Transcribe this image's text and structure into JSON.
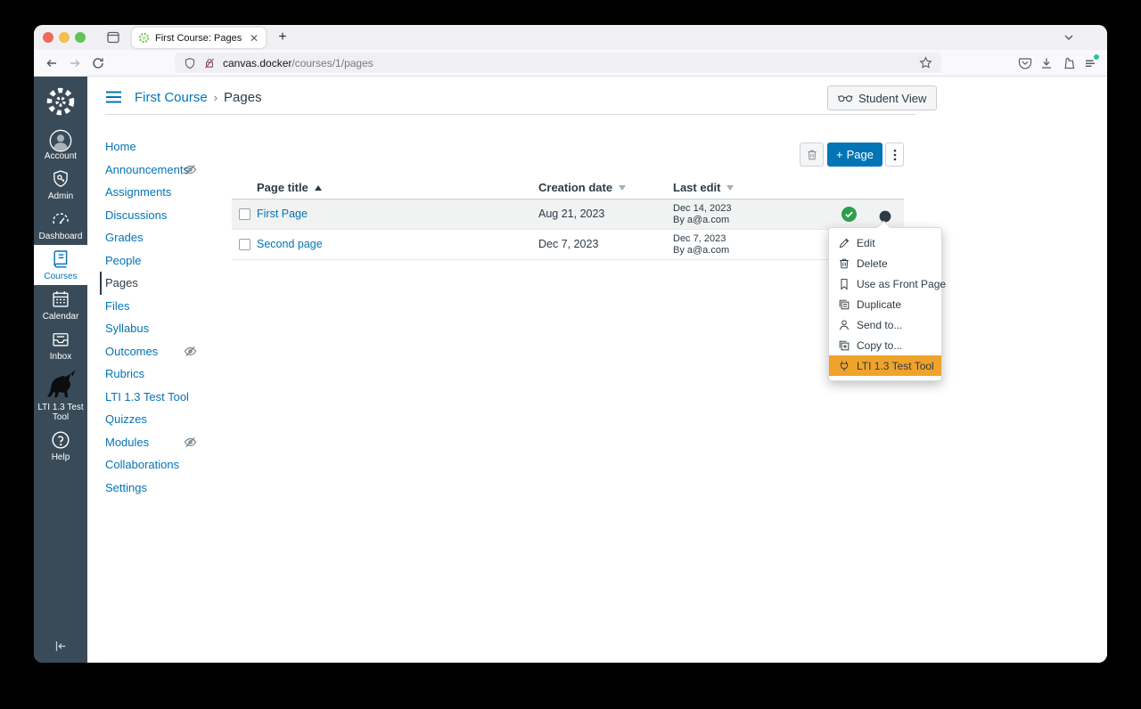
{
  "colors": {
    "accent_blue": "#0374B5",
    "sidebar_bg": "#394B58",
    "published_green": "#2D9F4B",
    "menu_highlight_orange": "#F0A32B"
  },
  "browser": {
    "tab_title": "First Course: Pages",
    "url_host": "canvas.docker",
    "url_path": "/courses/1/pages"
  },
  "global_nav": {
    "items": [
      {
        "label": "Account",
        "icon": "avatar-icon"
      },
      {
        "label": "Admin",
        "icon": "shield-key-icon"
      },
      {
        "label": "Dashboard",
        "icon": "gauge-icon"
      },
      {
        "label": "Courses",
        "icon": "book-icon",
        "active": true
      },
      {
        "label": "Calendar",
        "icon": "calendar-icon"
      },
      {
        "label": "Inbox",
        "icon": "inbox-icon"
      },
      {
        "label": "LTI 1.3 Test Tool",
        "icon": "unicorn-icon"
      },
      {
        "label": "Help",
        "icon": "help-icon"
      }
    ]
  },
  "page": {
    "breadcrumb_course": "First Course",
    "breadcrumb_separator": "›",
    "breadcrumb_current": "Pages",
    "student_view_label": "Student View"
  },
  "course_nav": {
    "items": [
      {
        "label": "Home"
      },
      {
        "label": "Announcements",
        "hidden": true
      },
      {
        "label": "Assignments"
      },
      {
        "label": "Discussions"
      },
      {
        "label": "Grades"
      },
      {
        "label": "People"
      },
      {
        "label": "Pages",
        "active": true
      },
      {
        "label": "Files"
      },
      {
        "label": "Syllabus"
      },
      {
        "label": "Outcomes",
        "hidden": true
      },
      {
        "label": "Rubrics"
      },
      {
        "label": "LTI 1.3 Test Tool"
      },
      {
        "label": "Quizzes"
      },
      {
        "label": "Modules",
        "hidden": true
      },
      {
        "label": "Collaborations"
      },
      {
        "label": "Settings"
      }
    ]
  },
  "actions": {
    "add_page_label": "Page"
  },
  "pages_table": {
    "columns": [
      {
        "label": "Page title",
        "sort": "asc"
      },
      {
        "label": "Creation date",
        "sort": "desc"
      },
      {
        "label": "Last edit",
        "sort": "desc"
      }
    ],
    "rows": [
      {
        "title": "First Page",
        "creation_date": "Aug 21, 2023",
        "last_edit_date": "Dec 14, 2023",
        "last_edit_by": "By a@a.com",
        "published": true,
        "highlighted": true,
        "show_menu_button": true
      },
      {
        "title": "Second page",
        "creation_date": "Dec 7, 2023",
        "last_edit_date": "Dec 7, 2023",
        "last_edit_by": "By a@a.com"
      }
    ]
  },
  "context_menu": {
    "items": [
      {
        "label": "Edit",
        "icon": "pencil-icon"
      },
      {
        "label": "Delete",
        "icon": "trash-icon"
      },
      {
        "label": "Use as Front Page",
        "icon": "bookmark-icon"
      },
      {
        "label": "Duplicate",
        "icon": "duplicate-icon"
      },
      {
        "label": "Send to...",
        "icon": "person-icon"
      },
      {
        "label": "Copy to...",
        "icon": "copy-plus-icon"
      },
      {
        "label": "LTI 1.3 Test Tool",
        "icon": "plug-icon",
        "highlighted": true
      }
    ]
  }
}
